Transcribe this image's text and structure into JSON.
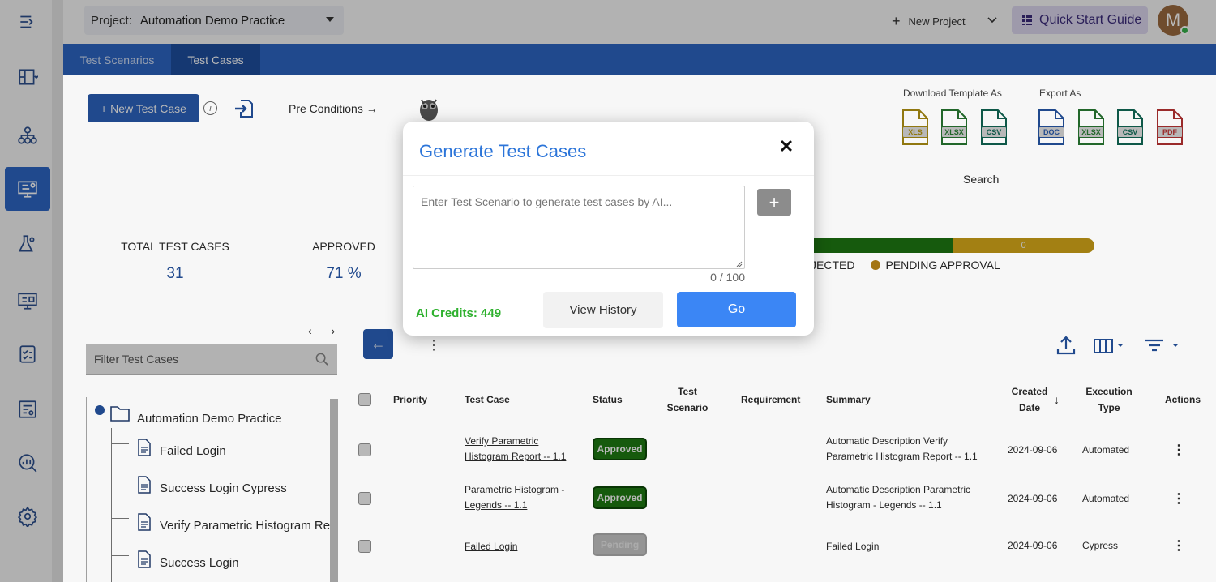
{
  "header": {
    "project_label": "Project:",
    "project_value": "Automation Demo Practice",
    "new_project": "New Project",
    "quick_start": "Quick Start Guide",
    "avatar_initial": "M"
  },
  "tabs": [
    {
      "label": "Test Scenarios",
      "active": false
    },
    {
      "label": "Test Cases",
      "active": true
    }
  ],
  "toolbar": {
    "new_test_case": "+ New Test Case",
    "pre_conditions": "Pre Conditions →",
    "download_label": "Download Template As",
    "export_label": "Export As",
    "download_formats": [
      "XLS",
      "XLSX",
      "CSV"
    ],
    "export_formats": [
      "DOC",
      "XLSX",
      "CSV",
      "PDF"
    ],
    "search_label": "Search"
  },
  "stats": {
    "total_label": "TOTAL TEST CASES",
    "total_value": "31",
    "approved_label": "APPROVED",
    "approved_value": "71 %",
    "legend_rejected": "JECTED",
    "legend_pending": "PENDING APPROVAL",
    "pending_bar_value": "0",
    "colors": {
      "approved": "#1e7d12",
      "pending": "#e2b21b"
    }
  },
  "tree": {
    "filter_placeholder": "Filter Test Cases",
    "root": "Automation Demo Practice",
    "items": [
      "Failed Login",
      "Success Login Cypress",
      "Verify Parametric Histogram Repo",
      "Success Login"
    ]
  },
  "table": {
    "headers": {
      "priority": "Priority",
      "test_case": "Test Case",
      "status": "Status",
      "test_scenario": "Test Scenario",
      "requirement": "Requirement",
      "summary": "Summary",
      "created_date": "Created Date",
      "execution_type": "Execution Type",
      "actions": "Actions"
    },
    "rows": [
      {
        "test_case_l1": "Verify Parametric",
        "test_case_l2": "Histogram Report -- 1.1",
        "status": "Approved",
        "summary_l1": "Automatic Description Verify",
        "summary_l2": "Parametric Histogram Report -- 1.1",
        "date": "2024-09-06",
        "exec": "Automated"
      },
      {
        "test_case_l1": "Parametric Histogram -",
        "test_case_l2": "Legends -- 1.1",
        "status": "Approved",
        "summary_l1": "Automatic Description Parametric",
        "summary_l2": "Histogram - Legends -- 1.1",
        "date": "2024-09-06",
        "exec": "Automated"
      },
      {
        "test_case_l1": "Failed Login",
        "test_case_l2": "",
        "status": "Pending",
        "summary_l1": "Failed Login",
        "summary_l2": "",
        "date": "2024-09-06",
        "exec": "Cypress"
      }
    ]
  },
  "modal": {
    "title": "Generate Test Cases",
    "close": "✕",
    "placeholder": "Enter Test Scenario to generate test cases by AI...",
    "counter": "0 / 100",
    "plus": "+",
    "credits": "AI Credits: 449",
    "view_history": "View History",
    "go": "Go"
  }
}
